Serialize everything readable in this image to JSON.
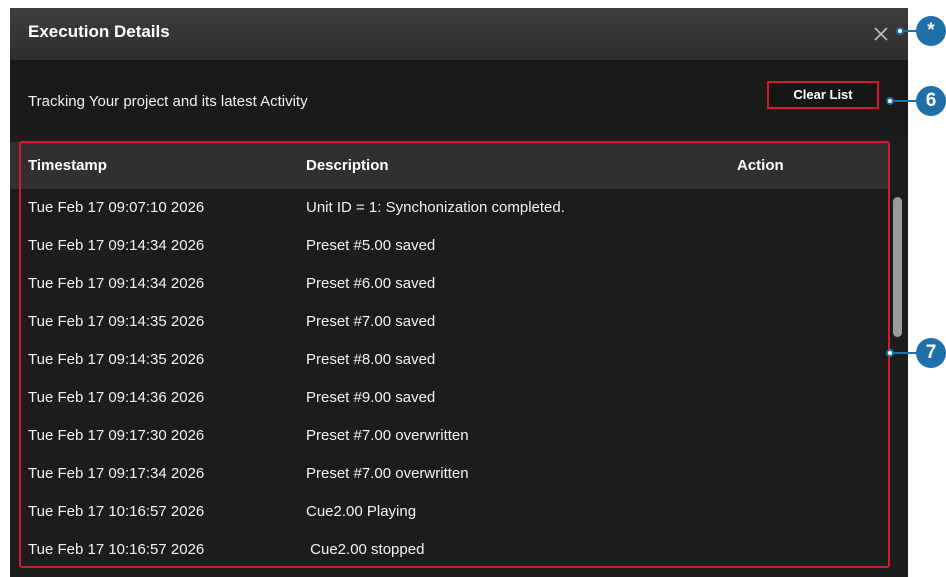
{
  "dialog": {
    "title": "Execution Details",
    "subtitle": "Tracking Your project and its latest Activity",
    "clear_button": "Clear List"
  },
  "table": {
    "columns": [
      "Timestamp",
      "Description",
      "Action"
    ],
    "rows": [
      {
        "timestamp": "Tue Feb 17 09:07:10 2026",
        "description": "Unit ID = 1: Synchonization completed.",
        "action": ""
      },
      {
        "timestamp": "Tue Feb 17 09:14:34 2026",
        "description": "Preset #5.00 saved",
        "action": ""
      },
      {
        "timestamp": "Tue Feb 17 09:14:34 2026",
        "description": "Preset #6.00 saved",
        "action": ""
      },
      {
        "timestamp": "Tue Feb 17 09:14:35 2026",
        "description": "Preset #7.00 saved",
        "action": ""
      },
      {
        "timestamp": "Tue Feb 17 09:14:35 2026",
        "description": "Preset #8.00 saved",
        "action": ""
      },
      {
        "timestamp": "Tue Feb 17 09:14:36 2026",
        "description": "Preset #9.00 saved",
        "action": ""
      },
      {
        "timestamp": "Tue Feb 17 09:17:30 2026",
        "description": "Preset #7.00 overwritten",
        "action": ""
      },
      {
        "timestamp": "Tue Feb 17 09:17:34 2026",
        "description": "Preset #7.00 overwritten",
        "action": ""
      },
      {
        "timestamp": "Tue Feb 17 10:16:57 2026",
        "description": "Cue2.00 Playing",
        "action": ""
      },
      {
        "timestamp": "Tue Feb 17 10:16:57 2026",
        "description": " Cue2.00 stopped",
        "action": ""
      }
    ]
  },
  "callouts": [
    "*",
    "6",
    "7"
  ],
  "colors": {
    "highlight": "#d4182f",
    "callout": "#1f6fa8",
    "dialog_bg": "#1c1c1c",
    "header_bg": "#303030"
  },
  "icons": {
    "close": "close-icon"
  }
}
